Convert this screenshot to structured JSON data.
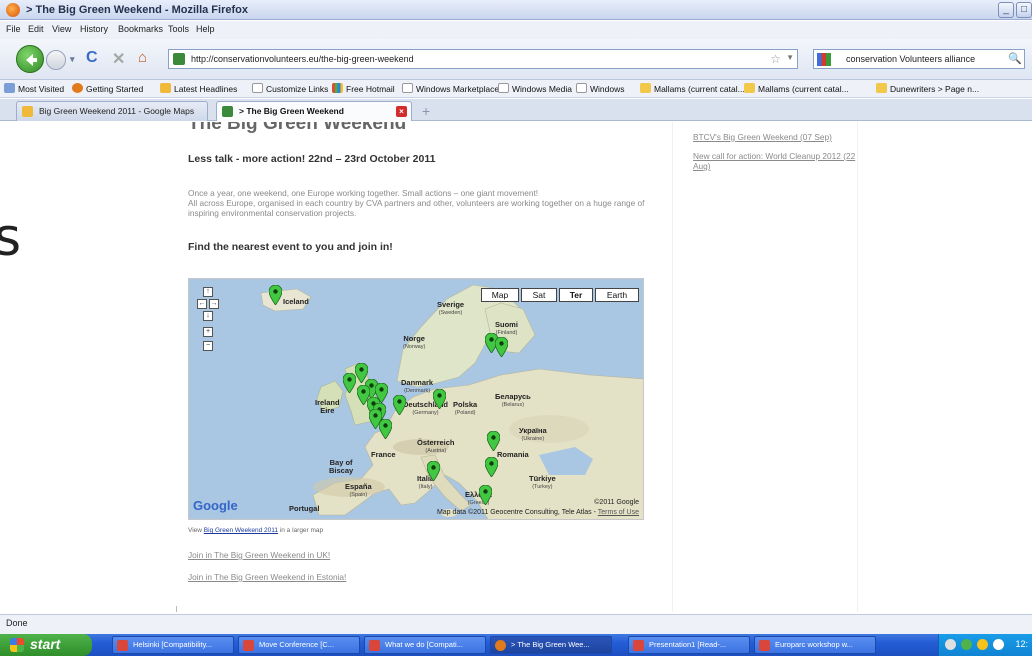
{
  "window": {
    "title": "> The Big Green Weekend - Mozilla Firefox"
  },
  "menu": [
    "File",
    "Edit",
    "View",
    "History",
    "Bookmarks",
    "Tools",
    "Help"
  ],
  "nav": {
    "url": "http://conservationvolunteers.eu/the-big-green-weekend",
    "search_value": "conservation Volunteers alliance"
  },
  "bookmarks": [
    "Most Visited",
    "Getting Started",
    "Latest Headlines",
    "Customize Links",
    "Free Hotmail",
    "Windows Marketplace",
    "Windows Media",
    "Windows",
    "Mallams (current catal...",
    "Mallams (current catal...",
    "Dunewriters > Page n..."
  ],
  "tabs": [
    "Big Green Weekend 2011 - Google Maps",
    "> The Big Green Weekend"
  ],
  "content": {
    "heading": "The Big Green Weekend",
    "subheading": "Less talk - more action!  22nd – 23rd October 2011",
    "intro_1": "Once a year, one weekend, one Europe working together. Small actions – one giant movement!",
    "intro_2": "All across Europe, organised in each country by CVA partners and other, volunteers are working together on a huge range of inspiring environmental conservation projects.",
    "find_heading": "Find the nearest event to you and join in!",
    "view_prefix": "View",
    "view_link": "Big Green Weekend 2011",
    "view_suffix": "in a larger map",
    "join_uk": "Join in The Big Green Weekend in UK!",
    "join_estonia": "Join in The Big Green Weekend in Estonia!"
  },
  "sidebar": {
    "link_1": "BTCV's Big Green Weekend (07 Sep)",
    "link_2": "New call for action: World Cleanup 2012 (22 Aug)"
  },
  "map": {
    "types": [
      "Map",
      "Sat",
      "Ter",
      "Earth"
    ],
    "selected_type": "Ter",
    "labels": [
      {
        "name": "Iceland",
        "sub": ""
      },
      {
        "name": "Sverige",
        "sub": "(Sweden)"
      },
      {
        "name": "Suomi",
        "sub": "(Finland)"
      },
      {
        "name": "Norge",
        "sub": "(Norway)"
      },
      {
        "name": "Danmark",
        "sub": "(Denmark)"
      },
      {
        "name": "Ireland",
        "sub": "Eire"
      },
      {
        "name": "Deutschland",
        "sub": "(Germany)"
      },
      {
        "name": "Polska",
        "sub": "(Poland)"
      },
      {
        "name": "Беларусь",
        "sub": "(Belarus)"
      },
      {
        "name": "Україна",
        "sub": "(Ukraine)"
      },
      {
        "name": "Österreich",
        "sub": "(Austria)"
      },
      {
        "name": "France",
        "sub": ""
      },
      {
        "name": "Bay of",
        "sub": "Biscay"
      },
      {
        "name": "Romania",
        "sub": ""
      },
      {
        "name": "España",
        "sub": "(Spain)"
      },
      {
        "name": "Portugal",
        "sub": ""
      },
      {
        "name": "Türkiye",
        "sub": "(Turkey)"
      },
      {
        "name": "Italia",
        "sub": "(Italy)"
      },
      {
        "name": "Ελλάδα",
        "sub": "(Greece)"
      }
    ],
    "logo": "Google",
    "copyright": "©2011 Google",
    "attribution": "Map data ©2011 Geocentre Consulting, Tele Atlas -",
    "terms": "Terms of Use",
    "marker_color": "#42c742"
  },
  "status": {
    "text": "Done"
  },
  "taskbar": {
    "start": "start",
    "items": [
      "Helsinki [Compatibility...",
      "Move Conference [C...",
      "What we do [Compati...",
      "> The Big Green Wee...",
      "Presentation1 [Read-...",
      "Europarc workshop w..."
    ],
    "clock": "12:"
  },
  "page_fragment": "s"
}
